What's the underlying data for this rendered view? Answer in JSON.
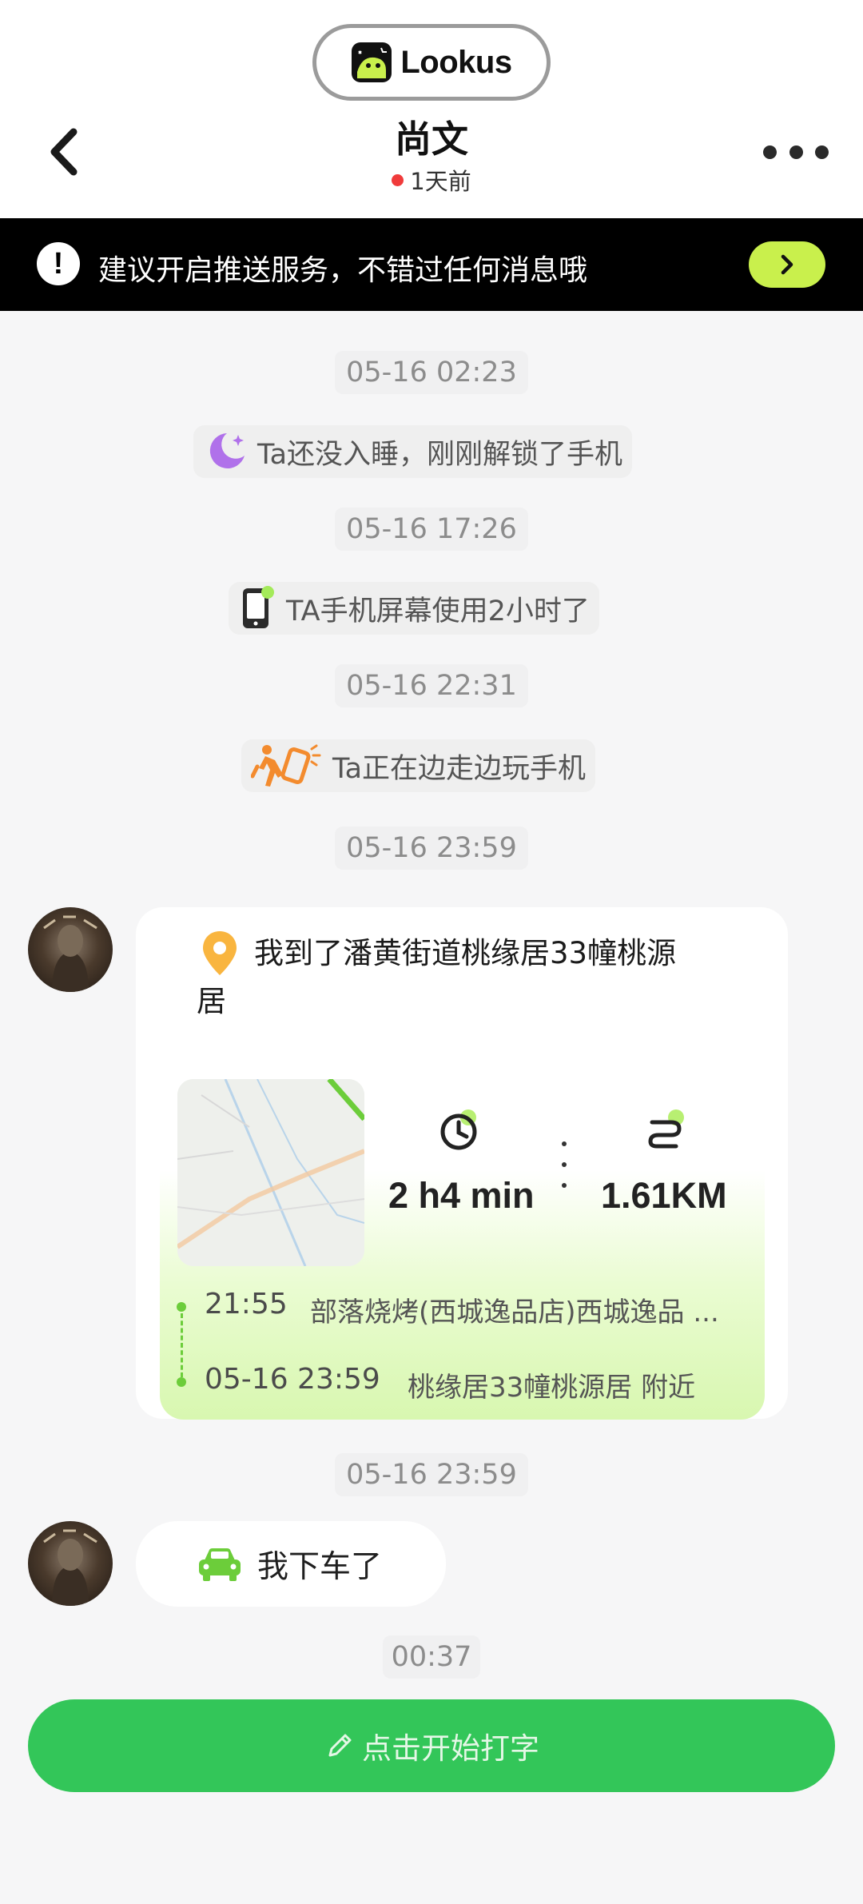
{
  "header": {
    "brand": "Lookus",
    "title": "尚文",
    "status": "1天前",
    "status_dot_color": "#f03b3b",
    "back_icon": "chevron-left-icon",
    "more_icon": "more-horizontal-icon"
  },
  "banner": {
    "text": "建议开启推送服务，不错过任何消息哦",
    "alert_icon": "!",
    "button_icon": "chevron-right-icon",
    "button_color": "#c9f04c"
  },
  "feed": {
    "ts1": "05-16 02:23",
    "event1": "Ta还没入睡，刚刚解锁了手机",
    "event1_icon": "moon-icon",
    "ts2": "05-16 17:26",
    "event2": "TA手机屏幕使用2小时了",
    "event2_icon": "phone-icon",
    "ts3": "05-16 22:31",
    "event3": "Ta正在边走边玩手机",
    "event3_icon": "walking-phone-icon",
    "ts4": "05-16 23:59",
    "location": {
      "title": "我到了潘黄街道桃缘居33幢桃源居",
      "pin_icon": "location-pin-icon",
      "duration": "2 h4 min",
      "distance": "1.61KM",
      "from_time": "21:55",
      "from_place": "部落烧烤(西城逸品店)西城逸品 ...",
      "to_time": "05-16 23:59",
      "to_place": "桃缘居33幢桃源居 附近"
    },
    "ts5": "05-16 23:59",
    "car_event": "我下车了",
    "car_icon": "car-icon",
    "ts6": "00:37"
  },
  "input": {
    "placeholder": "点击开始打字",
    "icon": "pencil-icon",
    "color": "#33c659"
  },
  "colors": {
    "accent_green": "#6ccd3a",
    "lime": "#c9f04c",
    "background": "#f6f6f7"
  }
}
